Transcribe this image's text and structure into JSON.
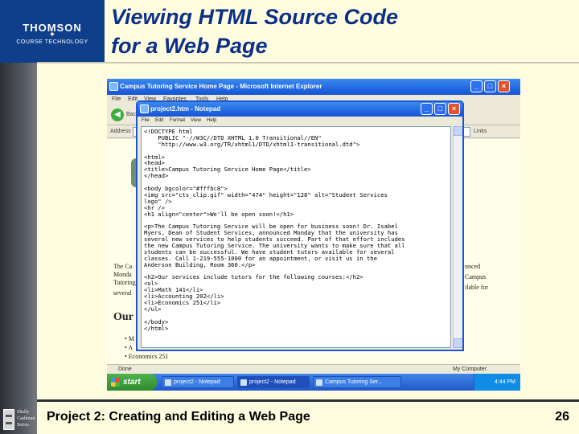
{
  "slide": {
    "title_line1": "Viewing HTML Source Code",
    "title_line2": "for a Web Page",
    "footer_title": "Project 2: Creating and Editing a Web Page",
    "page_number": "26",
    "logo_name": "THOMSON",
    "logo_sub": "COURSE TECHNOLOGY",
    "publisher_lines": [
      "Shelly",
      "Cashman",
      "Series."
    ]
  },
  "browser": {
    "title": "Campus Tutoring Service Home Page - Microsoft Internet Explorer",
    "menu": [
      "File",
      "Edit",
      "View",
      "Favorites",
      "Tools",
      "Help"
    ],
    "back_label": "Back",
    "address_label": "Address",
    "links_label": "Links",
    "status_left": "Done",
    "status_right": "My Computer",
    "page": {
      "logo_letter": "S",
      "para_lines": [
        "The Ca",
        "Monda",
        "Tutoring",
        "several"
      ],
      "para_right": [
        "nnced",
        "Campus",
        "ilable for"
      ],
      "heading": "Our",
      "bullets": [
        "M",
        "A",
        "Economics 251"
      ]
    }
  },
  "notepad": {
    "title": "project2.htm - Notepad",
    "menu": [
      "File",
      "Edit",
      "Format",
      "View",
      "Help"
    ],
    "lines": [
      "<!DOCTYPE html",
      "    PUBLIC \"-//W3C//DTD XHTML 1.0 Transitional//EN\"",
      "    \"http://www.w3.org/TR/xhtml1/DTD/xhtml1-transitional.dtd\">",
      "",
      "<html>",
      "<head>",
      "<title>Campus Tutoring Service Home Page</title>",
      "</head>",
      "",
      "<body bgcolor=\"#fffbc8\">",
      "<img src=\"cts_clip.gif\" width=\"474\" height=\"128\" alt=\"Student Services",
      "logo\" />",
      "<hr />",
      "<h1 align=\"center\">We'll be open soon!</h1>",
      "",
      "<p>The Campus Tutoring Service will be open for business soon! Dr. Isabel",
      "Myers, Dean of Student Services, announced Monday that the university has",
      "several new services to help students succeed. Part of that effort includes",
      "the new Campus Tutoring Service. The university wants to make sure that all",
      "students can be successful. We have student tutors available for several",
      "classes. Call 1-219-555-1000 for an appointment, or visit us in the",
      "Anderson Building, Room 360.</p>",
      "",
      "<h2>Our services include tutors for the following courses:</h2>",
      "<ul>",
      "<li>Math 141</li>",
      "<li>Accounting 202</li>",
      "<li>Economics 251</li>",
      "</ul>",
      "",
      "</body>",
      "</html>"
    ]
  },
  "taskbar": {
    "start_label": "start",
    "items": [
      "project2 - Notepad",
      "project2 - Notepad",
      "Campus Tutoring Ser..."
    ],
    "clock": "4:44 PM"
  }
}
